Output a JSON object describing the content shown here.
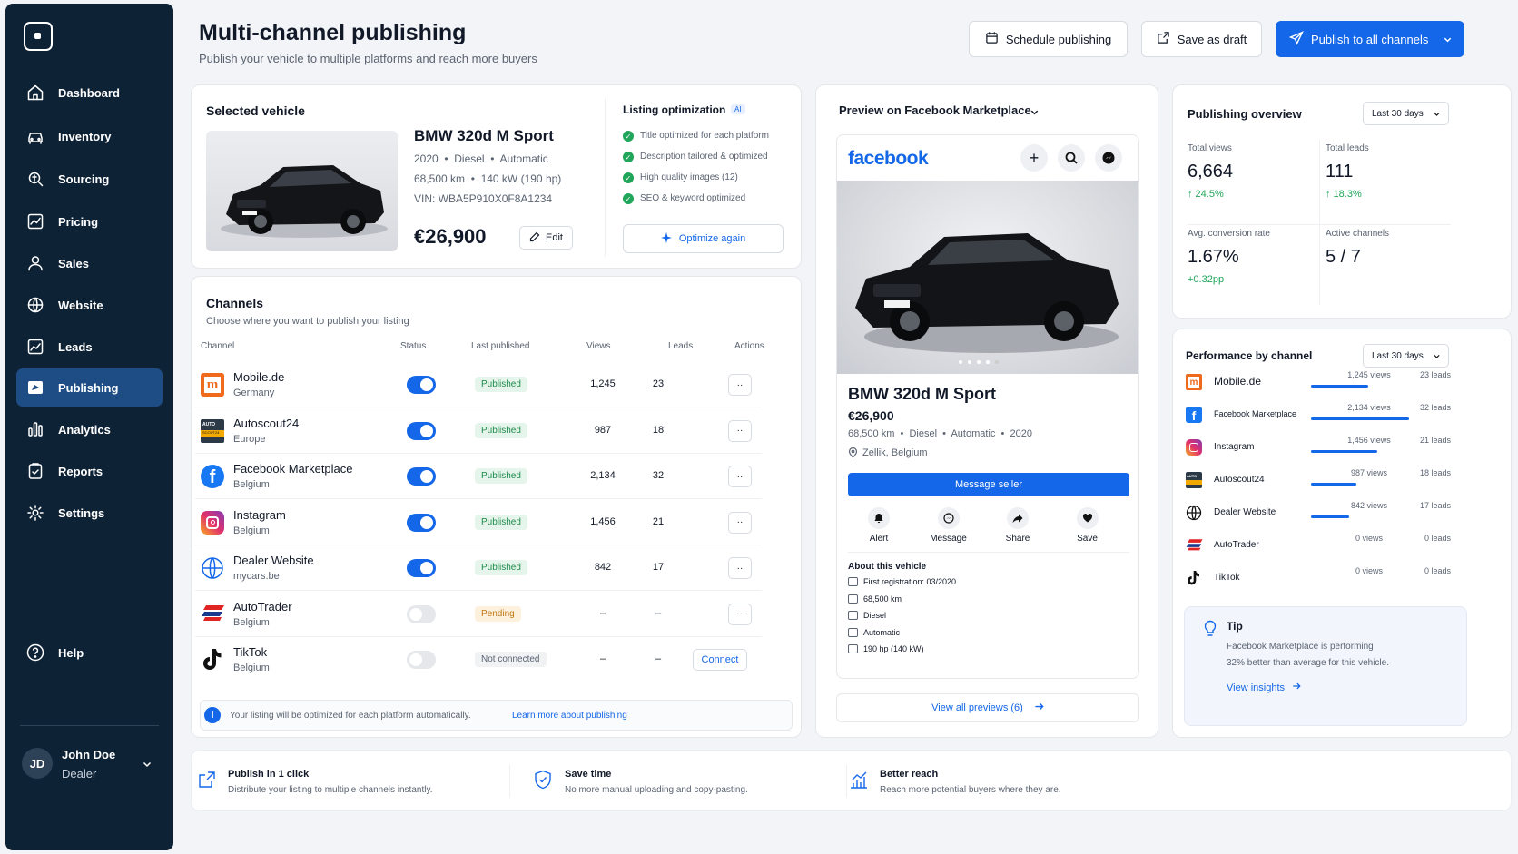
{
  "sidebar": {
    "items": [
      {
        "label": "Dashboard",
        "icon": "home-icon"
      },
      {
        "label": "Inventory",
        "icon": "car-icon"
      },
      {
        "label": "Sourcing",
        "icon": "sourcing-icon"
      },
      {
        "label": "Pricing",
        "icon": "pricing-chart-icon"
      },
      {
        "label": "Sales",
        "icon": "sales-person-icon"
      },
      {
        "label": "Website",
        "icon": "globe-icon"
      },
      {
        "label": "Leads",
        "icon": "leads-chart-icon"
      },
      {
        "label": "Publishing",
        "icon": "publishing-icon"
      },
      {
        "label": "Analytics",
        "icon": "analytics-bars-icon"
      },
      {
        "label": "Reports",
        "icon": "reports-icon"
      },
      {
        "label": "Settings",
        "icon": "gear-icon"
      }
    ],
    "help": "Help",
    "user": {
      "initials": "JD",
      "name": "John Doe",
      "role": "Dealer"
    }
  },
  "header": {
    "title": "Multi-channel publishing",
    "subtitle": "Publish your vehicle to multiple platforms and reach more buyers",
    "schedule": "Schedule publishing",
    "draft": "Save as draft",
    "publish": "Publish to all channels"
  },
  "vehicle": {
    "section": "Selected vehicle",
    "name": "BMW 320d M Sport",
    "specs1": "2020  •  Diesel  •  Automatic",
    "specs2": "68,500 km  •  140 kW (190 hp)",
    "vin": "VIN: WBA5P910X0F8A1234",
    "price": "€26,900",
    "edit": "Edit"
  },
  "optimization": {
    "title": "Listing optimization",
    "badge": "AI",
    "items": [
      "Title optimized for each platform",
      "Description tailored & optimized",
      "High quality images (12)",
      "SEO & keyword optimized"
    ],
    "button": "Optimize again"
  },
  "channels": {
    "title": "Channels",
    "subtitle": "Choose where you want to publish your listing",
    "headers": [
      "Channel",
      "Status",
      "Last published",
      "Views",
      "Leads",
      "Actions"
    ],
    "rows": [
      {
        "name": "Mobile.de",
        "region": "Germany",
        "status": "Published",
        "views": "1,245",
        "leads": "23",
        "on": true,
        "color": "#f06a1c"
      },
      {
        "name": "Autoscout24",
        "region": "Europe",
        "status": "Published",
        "views": "987",
        "leads": "18",
        "on": true,
        "color": "#f2a900"
      },
      {
        "name": "Facebook Marketplace",
        "region": "Belgium",
        "status": "Published",
        "views": "2,134",
        "leads": "32",
        "on": true,
        "color": "#1877f2"
      },
      {
        "name": "Instagram",
        "region": "Belgium",
        "status": "Published",
        "views": "1,456",
        "leads": "21",
        "on": true,
        "color": "#d6249f"
      },
      {
        "name": "Dealer Website",
        "region": "mycars.be",
        "status": "Published",
        "views": "842",
        "leads": "17",
        "on": true,
        "color": "#1f2937"
      },
      {
        "name": "AutoTrader",
        "region": "Belgium",
        "status": "Pending",
        "views": "–",
        "leads": "–",
        "on": false,
        "color": "#e02424"
      },
      {
        "name": "TikTok",
        "region": "Belgium",
        "status": "Not connected",
        "views": "–",
        "leads": "–",
        "on": false,
        "color": "#000000"
      }
    ],
    "connect": "Connect",
    "info": "Your listing will be optimized for each platform automatically.",
    "info_link": "Learn more about publishing"
  },
  "preview": {
    "title": "Preview on Facebook Marketplace",
    "brand": "facebook",
    "car": "BMW 320d M Sport",
    "price": "€26,900",
    "specs": "68,500 km  •  Diesel  •  Automatic  •  2020",
    "location": "Zellik, Belgium",
    "message_seller": "Message seller",
    "actions": [
      "Alert",
      "Message",
      "Share",
      "Save"
    ],
    "about_title": "About this vehicle",
    "about": [
      "First registration: 03/2020",
      "68,500 km",
      "Diesel",
      "Automatic",
      "190 hp (140 kW)"
    ],
    "view_all": "View all previews (6)"
  },
  "overview": {
    "title": "Publishing overview",
    "range": "Last 30 days",
    "stats": [
      {
        "label": "Total views",
        "value": "6,664",
        "delta": "↑ 24.5%"
      },
      {
        "label": "Total leads",
        "value": "111",
        "delta": "↑ 18.3%"
      },
      {
        "label": "Avg. conversion rate",
        "value": "1.67%",
        "delta": "+0.32pp"
      },
      {
        "label": "Active channels",
        "value": "5 / 7",
        "delta": ""
      }
    ]
  },
  "performance": {
    "title": "Performance by channel",
    "range": "Last 30 days",
    "rows": [
      {
        "name": "Mobile.de",
        "views": "1,245 views",
        "leads": "23 leads",
        "share": 0.58
      },
      {
        "name": "Facebook Marketplace",
        "views": "2,134 views",
        "leads": "32 leads",
        "share": 1.0
      },
      {
        "name": "Instagram",
        "views": "1,456 views",
        "leads": "21 leads",
        "share": 0.68
      },
      {
        "name": "Autoscout24",
        "views": "987 views",
        "leads": "18 leads",
        "share": 0.46
      },
      {
        "name": "Dealer Website",
        "views": "842 views",
        "leads": "17 leads",
        "share": 0.39
      },
      {
        "name": "AutoTrader",
        "views": "0 views",
        "leads": "0 leads",
        "share": 0
      },
      {
        "name": "TikTok",
        "views": "0 views",
        "leads": "0 leads",
        "share": 0
      }
    ]
  },
  "tip": {
    "title": "Tip",
    "text1": "Facebook Marketplace is performing",
    "text2": "32% better than average for this vehicle.",
    "link": "View insights"
  },
  "features": [
    {
      "title": "Publish in 1 click",
      "text": "Distribute your listing to multiple channels instantly."
    },
    {
      "title": "Save time",
      "text": "No more manual uploading and copy-pasting."
    },
    {
      "title": "Better reach",
      "text": "Reach more potential buyers where they are."
    }
  ],
  "colors": {
    "accent": "#1467e8",
    "sidebar": "#0e2236",
    "success": "#21a55a"
  }
}
